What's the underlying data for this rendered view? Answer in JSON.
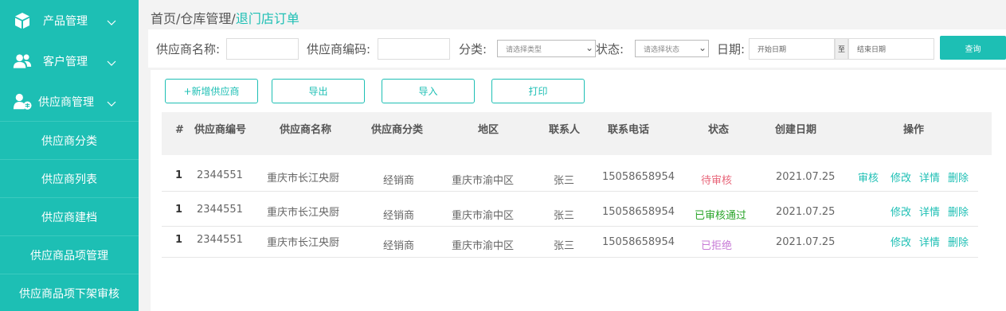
{
  "sidebar": {
    "menus": [
      {
        "label": "产品管理",
        "icon": "box-icon"
      },
      {
        "label": "客户管理",
        "icon": "users-icon"
      },
      {
        "label": "供应商管理",
        "icon": "supplier-icon"
      }
    ],
    "subitems": [
      "供应商分类",
      "供应商列表",
      "供应商建档",
      "供应商品项管理",
      "供应商品项下架审核"
    ]
  },
  "breadcrumb": {
    "home": "首页",
    "sep": "/",
    "warehouse": "仓库管理",
    "current": "退门店订单"
  },
  "filters": {
    "supplier_name_label": "供应商名称:",
    "supplier_code_label": "供应商编码:",
    "category_label": "分类:",
    "category_placeholder": "请选择类型",
    "status_label": "状态:",
    "status_placeholder": "请选择状态",
    "date_label": "日期:",
    "start_date": "开始日期",
    "date_separator": "至",
    "end_date": "结束日期",
    "search_button": "查询"
  },
  "toolbar": {
    "add": "+新增供应商",
    "export": "导出",
    "import": "导入",
    "print": "打印"
  },
  "table": {
    "headers": [
      "#",
      "供应商编号",
      "供应商名称",
      "供应商分类",
      "地区",
      "联系人",
      "联系电话",
      "状态",
      "创建日期",
      "操作"
    ],
    "rows": [
      {
        "idx": "1",
        "code": "2344551",
        "name": "重庆市长江央厨",
        "category": "经销商",
        "region": "重庆市渝中区",
        "contact": "张三",
        "phone": "15058658954",
        "status": "待审核",
        "status_color": "#e8667a",
        "date": "2021.07.25",
        "actions": [
          "审核",
          "修改",
          "详情",
          "删除"
        ]
      },
      {
        "idx": "1",
        "code": "2344551",
        "name": "重庆市长江央厨",
        "category": "经销商",
        "region": "重庆市渝中区",
        "contact": "张三",
        "phone": "15058658954",
        "status": "已审核通过",
        "status_color": "#2aa52a",
        "date": "2021.07.25",
        "actions": [
          "修改",
          "详情",
          "删除"
        ]
      },
      {
        "idx": "1",
        "code": "2344551",
        "name": "重庆市长江央厨",
        "category": "经销商",
        "region": "重庆市渝中区",
        "contact": "张三",
        "phone": "15058658954",
        "status": "已拒绝",
        "status_color": "#c77ad6",
        "date": "2021.07.25",
        "actions": [
          "修改",
          "详情",
          "删除"
        ]
      }
    ]
  },
  "colors": {
    "accent": "#1dbfb4"
  }
}
